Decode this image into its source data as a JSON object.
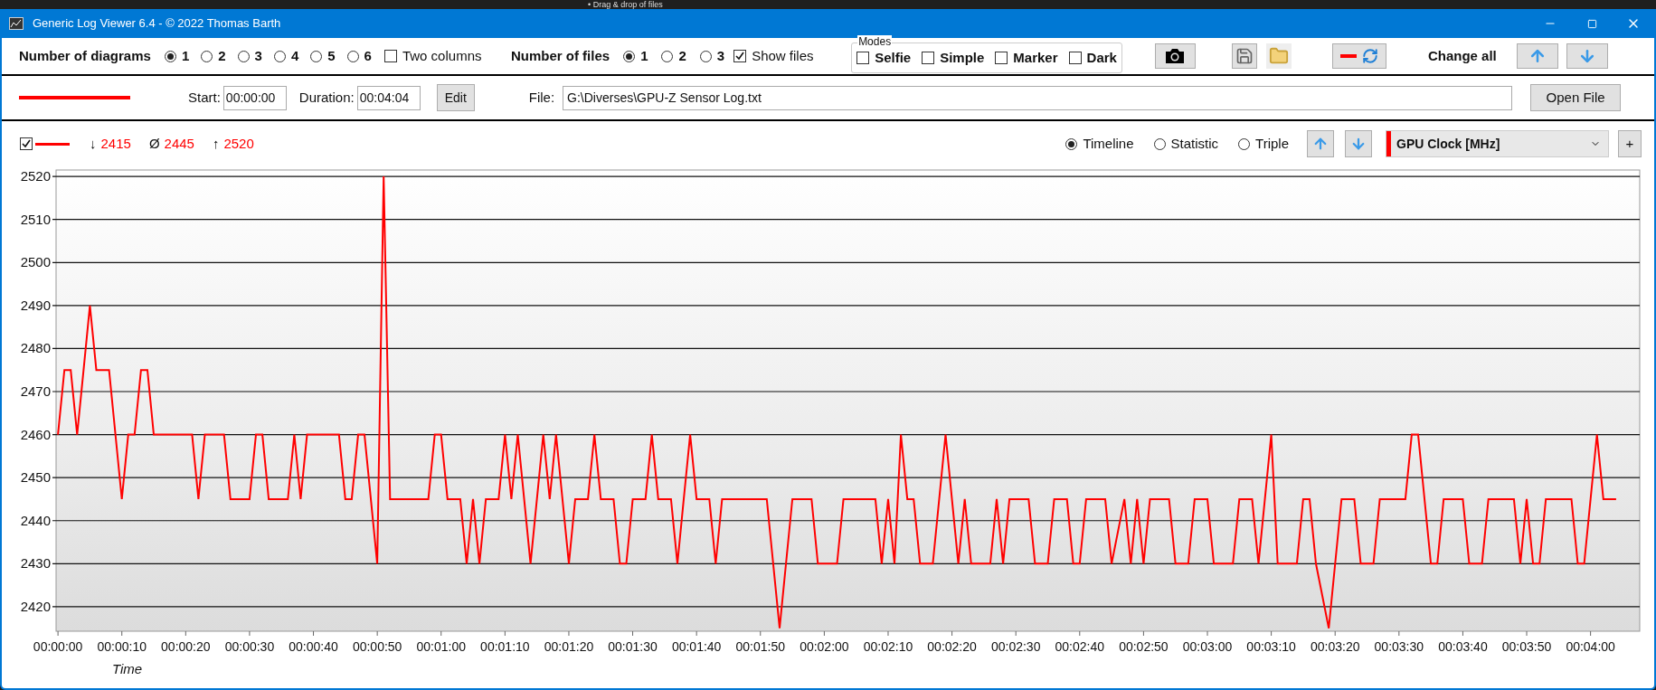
{
  "background_window": {
    "text": "• Drag & drop of files"
  },
  "window": {
    "title": "Generic Log Viewer 6.4 - © 2022 Thomas Barth"
  },
  "toolbar": {
    "diagrams": {
      "label": "Number of diagrams",
      "options": [
        {
          "label": "1",
          "selected": true
        },
        {
          "label": "2",
          "selected": false
        },
        {
          "label": "3",
          "selected": false
        },
        {
          "label": "4",
          "selected": false
        },
        {
          "label": "5",
          "selected": false
        },
        {
          "label": "6",
          "selected": false
        }
      ]
    },
    "two_columns": {
      "label": "Two columns",
      "checked": false
    },
    "files": {
      "label": "Number of files",
      "options": [
        {
          "label": "1",
          "selected": true
        },
        {
          "label": "2",
          "selected": false
        },
        {
          "label": "3",
          "selected": false
        }
      ]
    },
    "show_files": {
      "label": "Show files",
      "checked": true
    },
    "modes": {
      "title": "Modes",
      "items": [
        {
          "label": "Selfie",
          "checked": false
        },
        {
          "label": "Simple",
          "checked": false
        },
        {
          "label": "Marker",
          "checked": false
        },
        {
          "label": "Dark",
          "checked": false
        }
      ]
    },
    "change_all": "Change all"
  },
  "file_row": {
    "start_label": "Start:",
    "start": "00:00:00",
    "duration_label": "Duration:",
    "duration": "00:04:04",
    "edit": "Edit",
    "file_label": "File:",
    "file": "G:\\Diverses\\GPU-Z Sensor Log.txt",
    "open": "Open File"
  },
  "series_bar": {
    "visible": true,
    "stats": [
      {
        "symbol": "↓",
        "value": "2415"
      },
      {
        "symbol": "Ø",
        "value": "2445"
      },
      {
        "symbol": "↑",
        "value": "2520"
      }
    ],
    "views": [
      {
        "label": "Timeline",
        "selected": true
      },
      {
        "label": "Statistic",
        "selected": false
      },
      {
        "label": "Triple",
        "selected": false
      }
    ],
    "channel": {
      "name": "GPU Clock [MHz]",
      "color": "#ff0000"
    },
    "add": "+"
  },
  "chart": {
    "chart_data": {
      "type": "line",
      "xlabel": "Time",
      "x": [
        0,
        1,
        2,
        3,
        4,
        5,
        6,
        8,
        10,
        11,
        12,
        13,
        14,
        15,
        21,
        22,
        23,
        26,
        27,
        30,
        31,
        32,
        33,
        36,
        37,
        38,
        39,
        44,
        45,
        46,
        47,
        48,
        50,
        51,
        52,
        58,
        59,
        60,
        61,
        63,
        64,
        65,
        66,
        67,
        69,
        70,
        71,
        72,
        74,
        76,
        77,
        78,
        80,
        81,
        83,
        84,
        85,
        87,
        88,
        89,
        90,
        92,
        93,
        94,
        96,
        97,
        98,
        99,
        100,
        102,
        103,
        104,
        111,
        113,
        115,
        118,
        119,
        122,
        123,
        128,
        129,
        130,
        131,
        132,
        133,
        134,
        135,
        137,
        139,
        141,
        142,
        143,
        146,
        147,
        148,
        149,
        152,
        153,
        155,
        156,
        158,
        159,
        160,
        161,
        164,
        165,
        167,
        168,
        169,
        170,
        171,
        174,
        175,
        177,
        178,
        180,
        181,
        184,
        185,
        187,
        188,
        190,
        191,
        194,
        195,
        196,
        197,
        199,
        201,
        203,
        204,
        206,
        207,
        211,
        212,
        213,
        215,
        216,
        217,
        220,
        221,
        223,
        224,
        228,
        229,
        230,
        231,
        232,
        233,
        237,
        238,
        239,
        241,
        242,
        244
      ],
      "grid": true,
      "series": [
        {
          "color": "#ff0000",
          "values": [
            2460,
            2475,
            2475,
            2460,
            2475,
            2490,
            2475,
            2475,
            2445,
            2460,
            2460,
            2475,
            2475,
            2460,
            2460,
            2445,
            2460,
            2460,
            2445,
            2445,
            2460,
            2460,
            2445,
            2445,
            2460,
            2445,
            2460,
            2460,
            2445,
            2445,
            2460,
            2460,
            2430,
            2520,
            2445,
            2445,
            2460,
            2460,
            2445,
            2445,
            2430,
            2445,
            2430,
            2445,
            2445,
            2460,
            2445,
            2460,
            2430,
            2460,
            2445,
            2460,
            2430,
            2445,
            2445,
            2460,
            2445,
            2445,
            2430,
            2430,
            2445,
            2445,
            2460,
            2445,
            2445,
            2430,
            2445,
            2460,
            2445,
            2445,
            2430,
            2445,
            2445,
            2415,
            2445,
            2445,
            2430,
            2430,
            2445,
            2445,
            2430,
            2445,
            2430,
            2460,
            2445,
            2445,
            2430,
            2430,
            2460,
            2430,
            2445,
            2430,
            2430,
            2445,
            2430,
            2445,
            2445,
            2430,
            2430,
            2445,
            2445,
            2430,
            2430,
            2445,
            2445,
            2430,
            2445,
            2430,
            2445,
            2430,
            2445,
            2445,
            2430,
            2430,
            2445,
            2445,
            2430,
            2430,
            2445,
            2445,
            2430,
            2460,
            2430,
            2430,
            2445,
            2445,
            2430,
            2415,
            2445,
            2445,
            2430,
            2430,
            2445,
            2445,
            2460,
            2460,
            2430,
            2430,
            2445,
            2445,
            2430,
            2430,
            2445,
            2445,
            2430,
            2445,
            2430,
            2430,
            2445,
            2445,
            2430,
            2430,
            2460,
            2445,
            2445
          ]
        }
      ],
      "xlim": [
        -0.3,
        247.7
      ],
      "ylim": [
        2414.3,
        2521.5
      ],
      "yticks": [
        2420,
        2430,
        2440,
        2450,
        2460,
        2470,
        2480,
        2490,
        2500,
        2510,
        2520
      ],
      "xticks": [
        {
          "value": 0,
          "label": "00:00:00"
        },
        {
          "value": 10,
          "label": "00:00:10"
        },
        {
          "value": 20,
          "label": "00:00:20"
        },
        {
          "value": 30,
          "label": "00:00:30"
        },
        {
          "value": 40,
          "label": "00:00:40"
        },
        {
          "value": 50,
          "label": "00:00:50"
        },
        {
          "value": 60,
          "label": "00:01:00"
        },
        {
          "value": 70,
          "label": "00:01:10"
        },
        {
          "value": 80,
          "label": "00:01:20"
        },
        {
          "value": 90,
          "label": "00:01:30"
        },
        {
          "value": 100,
          "label": "00:01:40"
        },
        {
          "value": 110,
          "label": "00:01:50"
        },
        {
          "value": 120,
          "label": "00:02:00"
        },
        {
          "value": 130,
          "label": "00:02:10"
        },
        {
          "value": 140,
          "label": "00:02:20"
        },
        {
          "value": 150,
          "label": "00:02:30"
        },
        {
          "value": 160,
          "label": "00:02:40"
        },
        {
          "value": 170,
          "label": "00:02:50"
        },
        {
          "value": 180,
          "label": "00:03:00"
        },
        {
          "value": 190,
          "label": "00:03:10"
        },
        {
          "value": 200,
          "label": "00:03:20"
        },
        {
          "value": 210,
          "label": "00:03:30"
        },
        {
          "value": 220,
          "label": "00:03:40"
        },
        {
          "value": 230,
          "label": "00:03:50"
        },
        {
          "value": 240,
          "label": "00:04:00"
        }
      ]
    }
  }
}
